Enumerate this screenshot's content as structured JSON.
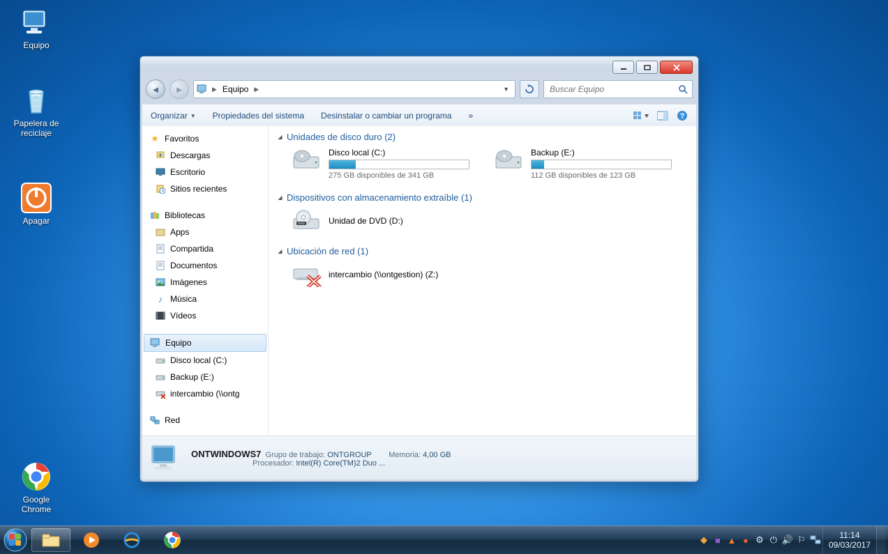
{
  "desktop": {
    "icons": [
      {
        "label": "Equipo"
      },
      {
        "label": "Papelera de reciclaje"
      },
      {
        "label": "Apagar"
      },
      {
        "label": "Google Chrome"
      }
    ]
  },
  "taskbar": {
    "clock_time": "11:14",
    "clock_date": "09/03/2017"
  },
  "window": {
    "breadcrumb_root": "Equipo",
    "search_placeholder": "Buscar Equipo",
    "toolbar": {
      "organize": "Organizar",
      "sys_props": "Propiedades del sistema",
      "uninstall": "Desinstalar o cambiar un programa",
      "more": "»"
    },
    "sidebar": {
      "favorites": "Favoritos",
      "fav_items": [
        "Descargas",
        "Escritorio",
        "Sitios recientes"
      ],
      "libraries": "Bibliotecas",
      "lib_items": [
        "Apps",
        "Compartida",
        "Documentos",
        "Imágenes",
        "Música",
        "Vídeos"
      ],
      "computer": "Equipo",
      "comp_items": [
        "Disco local (C:)",
        "Backup (E:)",
        "intercambio (\\\\ontg"
      ],
      "network": "Red"
    },
    "content": {
      "hdd_header": "Unidades de disco duro (2)",
      "drives": [
        {
          "name": "Disco local (C:)",
          "free_text": "275 GB disponibles de 341 GB",
          "fill_pct": 19
        },
        {
          "name": "Backup (E:)",
          "free_text": "112 GB disponibles de 123 GB",
          "fill_pct": 9
        }
      ],
      "removable_header": "Dispositivos con almacenamiento extraíble (1)",
      "dvd_name": "Unidad de DVD (D:)",
      "network_header": "Ubicación de red (1)",
      "netloc_name": "intercambio (\\\\ontgestion) (Z:)"
    },
    "details": {
      "name": "ONTWINDOWS7",
      "workgroup_k": "Grupo de trabajo:",
      "workgroup_v": "ONTGROUP",
      "cpu_k": "Procesador:",
      "cpu_v": "Intel(R) Core(TM)2 Duo ...",
      "mem_k": "Memoria:",
      "mem_v": "4,00 GB"
    }
  }
}
